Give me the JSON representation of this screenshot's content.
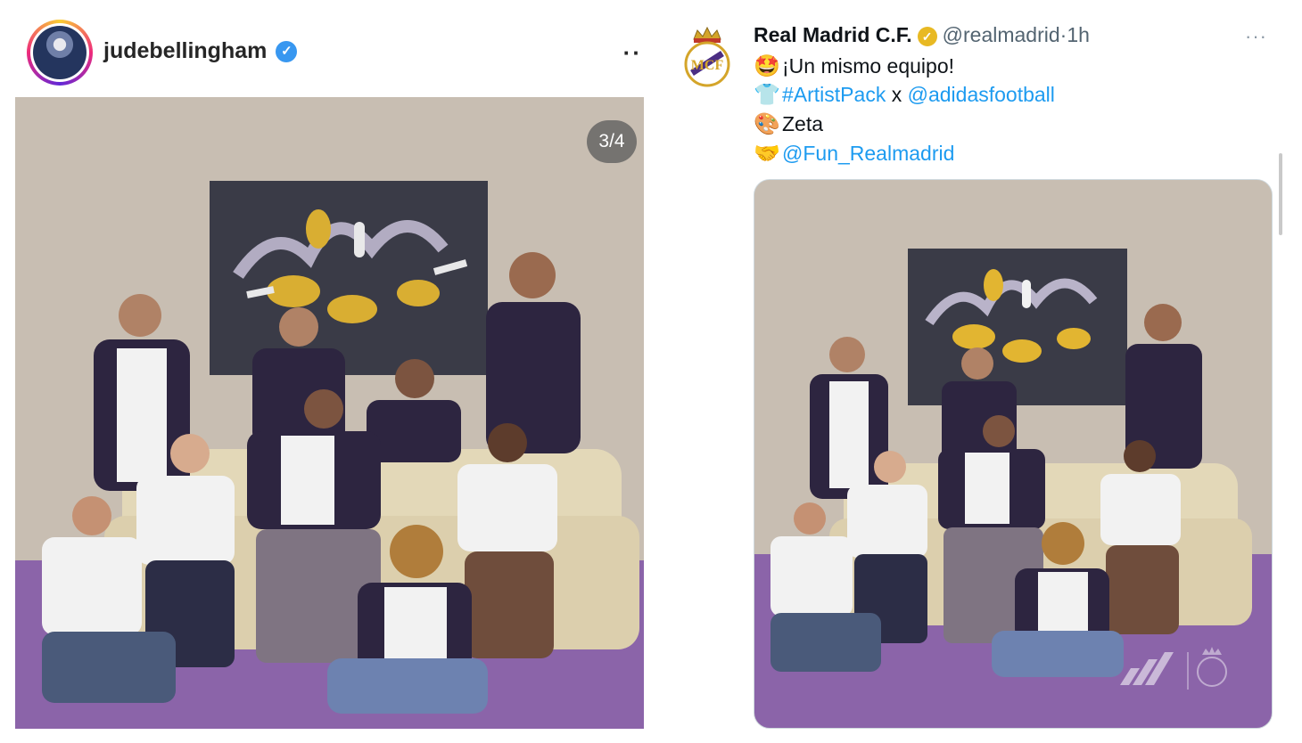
{
  "instagram": {
    "username": "judebellingham",
    "verified_icon": "verified-check-icon",
    "more_label": "··",
    "slide_counter": "3/4"
  },
  "tweet": {
    "display_name": "Real Madrid C.F.",
    "handle": "@realmadrid",
    "separator": "·",
    "time": "1h",
    "more_label": "···",
    "lines": [
      {
        "emoji": "🤩",
        "text": "¡Un mismo equipo!"
      },
      {
        "emoji": "👕",
        "hashtag": "#ArtistPack",
        "joiner": " x ",
        "mention": "@adidasfootball"
      },
      {
        "emoji": "🎨",
        "text": "Zeta"
      },
      {
        "emoji": "🤝",
        "mention": "@Fun_Realmadrid"
      }
    ]
  },
  "colors": {
    "wall": "#c9bfb3",
    "floor": "#8a63a8",
    "jacket": "#2d2540",
    "link": "#1d9bf0",
    "gold_badge": "#e8b923"
  }
}
